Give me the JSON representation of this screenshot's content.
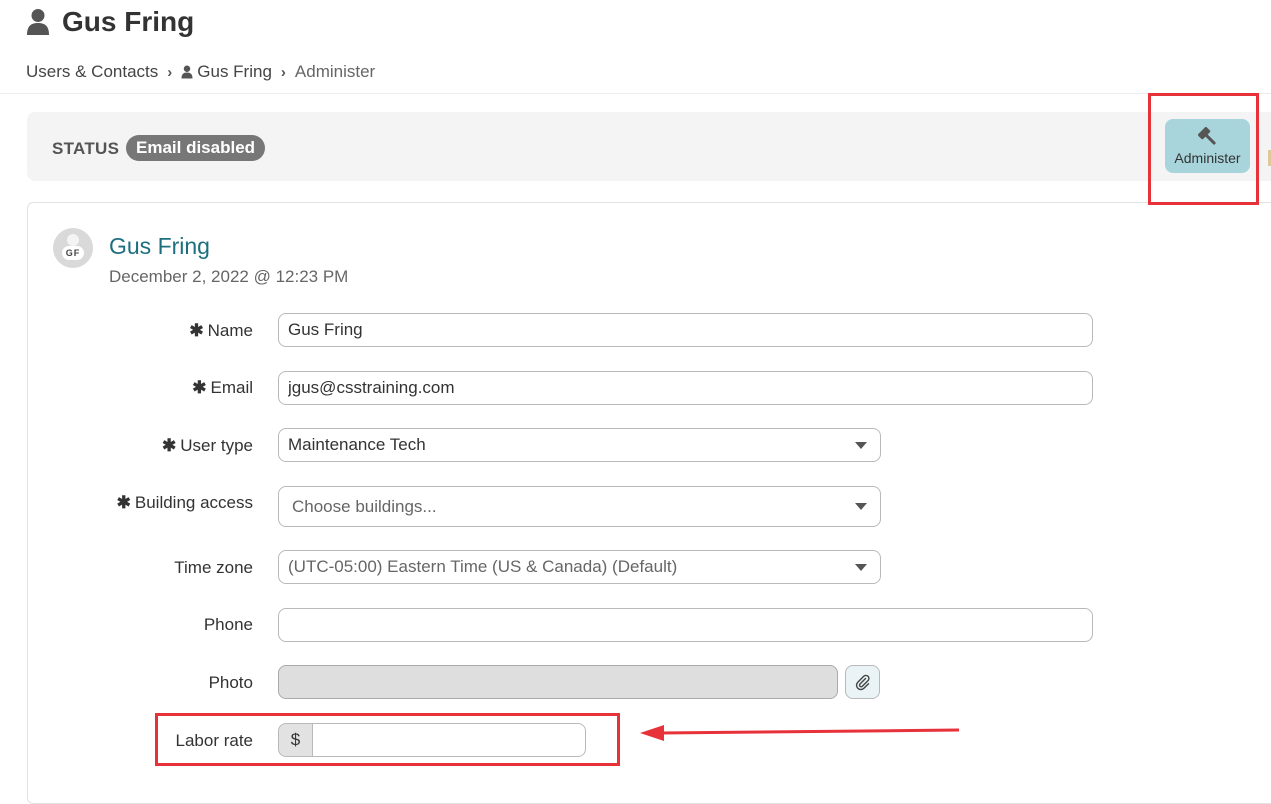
{
  "header": {
    "title": "Gus Fring",
    "title_icon": "user-icon"
  },
  "breadcrumb": {
    "items": [
      "Users & Contacts",
      "Gus Fring",
      "Administer"
    ],
    "separator": "›"
  },
  "status": {
    "label": "STATUS",
    "badge": "Email disabled"
  },
  "actions": {
    "administer_label": "Administer",
    "administer_icon": "gavel-icon"
  },
  "profile": {
    "initials": "GF",
    "name": "Gus Fring",
    "date": "December 2, 2022 @ 12:23 PM"
  },
  "form": {
    "required_mark": "✱",
    "name": {
      "label": "Name",
      "value": "Gus Fring"
    },
    "email": {
      "label": "Email",
      "value": "jgus@csstraining.com"
    },
    "user_type": {
      "label": "User type",
      "value": "Maintenance Tech"
    },
    "building_access": {
      "label": "Building access",
      "placeholder": "Choose buildings..."
    },
    "time_zone": {
      "label": "Time zone",
      "value": "(UTC-05:00) Eastern Time (US & Canada) (Default)"
    },
    "phone": {
      "label": "Phone",
      "value": ""
    },
    "photo": {
      "label": "Photo",
      "attach_icon": "paperclip-icon"
    },
    "labor_rate": {
      "label": "Labor rate",
      "prefix": "$",
      "value": ""
    }
  },
  "colors": {
    "accent": "#1d6f7f",
    "badge": "#777777",
    "administer_button": "#a8d4dc",
    "annotation": "#e8323a"
  }
}
